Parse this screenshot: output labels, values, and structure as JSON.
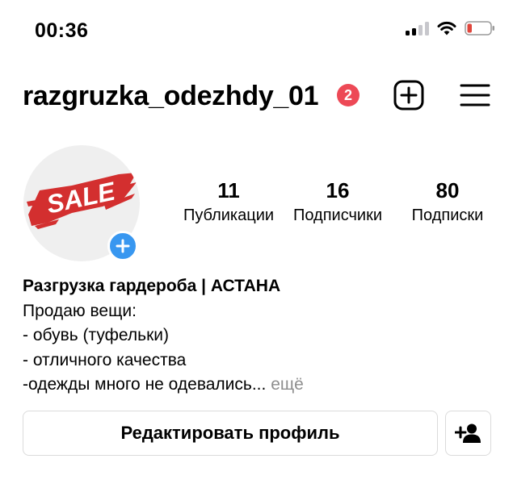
{
  "status_bar": {
    "time": "00:36",
    "icons": [
      "cellular-signal-icon",
      "wifi-icon",
      "battery-low-icon"
    ],
    "battery_color": "#e0463c"
  },
  "header": {
    "username": "razgruzka_odezhdy_01",
    "notification_count": "2",
    "icons": [
      "add-post-icon",
      "menu-icon"
    ]
  },
  "profile": {
    "avatar_text": "SALE",
    "avatar_brush_color": "#d32f2f",
    "add_story_color": "#3897f0",
    "stats": [
      {
        "value": "11",
        "label": "Публикации"
      },
      {
        "value": "16",
        "label": "Подписчики"
      },
      {
        "value": "80",
        "label": "Подписки"
      }
    ]
  },
  "bio": {
    "name": "Разгрузка гардероба | АСТАНА",
    "lines": [
      "Продаю вещи:",
      "- обувь (туфельки)",
      "- отличного качества",
      "-одежды много не одевались..."
    ],
    "more_label": "ещё"
  },
  "actions": {
    "edit_profile_label": "Редактировать профиль",
    "discover_people_icon": "add-person-icon"
  }
}
